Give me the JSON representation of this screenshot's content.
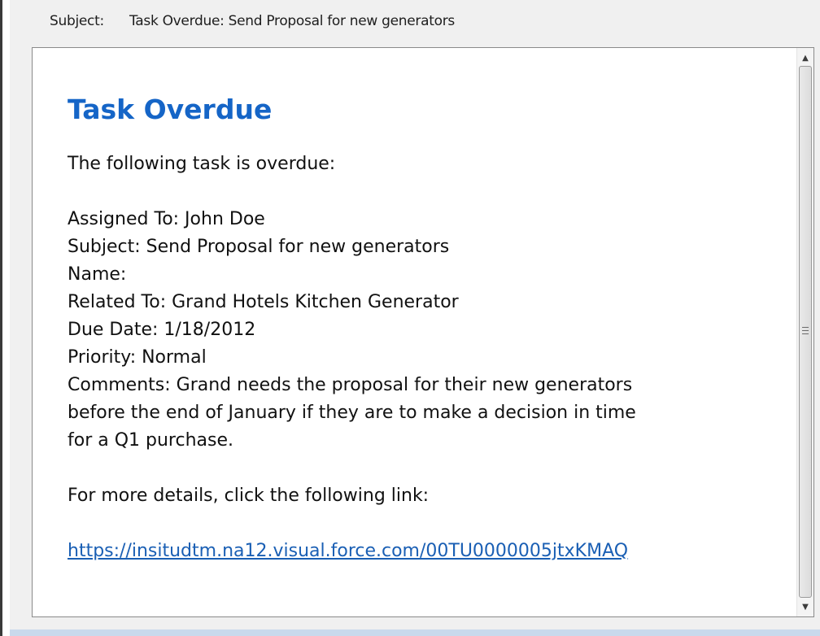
{
  "header": {
    "subject_label": "Subject:",
    "subject_value": "Task Overdue: Send Proposal for new generators"
  },
  "message": {
    "title": "Task Overdue",
    "intro": "The following task is overdue:",
    "assigned_to": "Assigned To: John Doe",
    "subject": "Subject: Send Proposal for new generators",
    "name": "Name:",
    "related_to": "Related To: Grand Hotels Kitchen Generator",
    "due_date": "Due Date: 1/18/2012",
    "priority": "Priority: Normal",
    "comments_line1": "Comments: Grand needs the proposal for their new generators",
    "comments_line2": "before the end of January if they are to make a decision in time",
    "comments_line3": "for a Q1 purchase.",
    "details_prompt": "For more details, click the following link:",
    "link": "https://insitudtm.na12.visual.force.com/00TU0000005jtxKMAQ"
  },
  "colors": {
    "title": "#1565c7",
    "link": "#1a5fb4",
    "chrome_background": "#f0f0f0",
    "bottom_border": "#c9d9ec"
  },
  "icons": {
    "scroll_up": "triangle-up",
    "scroll_down": "triangle-down",
    "thumb_grip": "grip-lines"
  },
  "scroll": {
    "up_glyph": "▲",
    "down_glyph": "▼"
  }
}
